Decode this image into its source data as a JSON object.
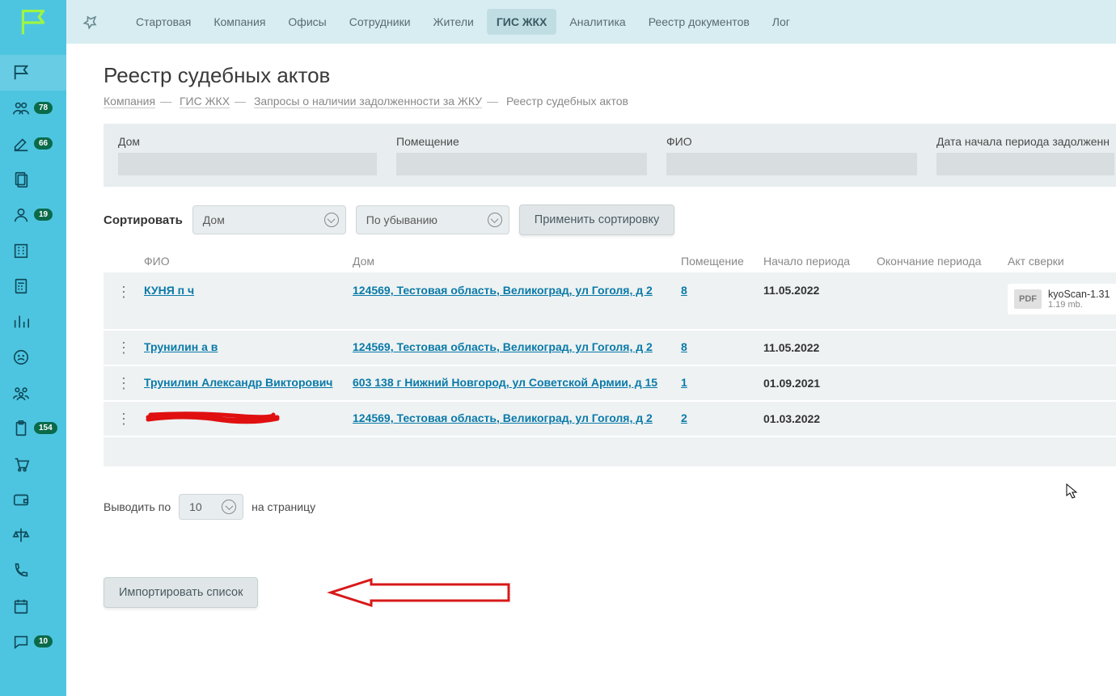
{
  "topnav": {
    "tabs": [
      "Стартовая",
      "Компания",
      "Офисы",
      "Сотрудники",
      "Жители",
      "ГИС ЖКХ",
      "Аналитика",
      "Реестр документов",
      "Лог"
    ],
    "active_index": 5
  },
  "sidebar": {
    "badges": {
      "i1": "78",
      "i2": "66",
      "i4": "19",
      "i11": "154",
      "i15": "10"
    }
  },
  "page": {
    "title": "Реестр судебных актов",
    "breadcrumb": {
      "items": [
        "Компания",
        "ГИС ЖКХ",
        "Запросы о наличии задолженности за ЖКУ"
      ],
      "current": "Реестр судебных актов"
    }
  },
  "filters": {
    "house_label": "Дом",
    "room_label": "Помещение",
    "fio_label": "ФИО",
    "date_start_label": "Дата начала периода задолженн"
  },
  "sort": {
    "label": "Сортировать",
    "field": "Дом",
    "direction": "По убыванию",
    "apply_btn": "Применить сортировку"
  },
  "table": {
    "headers": {
      "fio": "ФИО",
      "house": "Дом",
      "room": "Помещение",
      "start": "Начало периода",
      "end": "Окончание периода",
      "act": "Акт сверки"
    },
    "rows": [
      {
        "fio": "КУНЯ п ч",
        "house": "124569, Тестовая область, Великоград, ул Гоголя, д 2",
        "room": "8",
        "start": "11.05.2022",
        "end": "",
        "file": {
          "name": "kyoScan-1.31",
          "size": "1.19 mb."
        }
      },
      {
        "fio": "Трунилин а в",
        "house": "124569, Тестовая область, Великоград, ул Гоголя, д 2",
        "room": "8",
        "start": "11.05.2022",
        "end": ""
      },
      {
        "fio": "Трунилин Александр Викторович",
        "house": "603 138 г Нижний Новгород, ул Советской Армии, д 15",
        "room": "1",
        "start": "01.09.2021",
        "end": ""
      },
      {
        "fio": "[redacted]",
        "house": "124569, Тестовая область, Великоград, ул Гоголя, д 2",
        "room": "2",
        "start": "01.03.2022",
        "end": "",
        "redacted": true
      }
    ]
  },
  "pager": {
    "prefix": "Выводить по",
    "value": "10",
    "suffix": "на страницу"
  },
  "import_btn": "Импортировать список",
  "pdf_badge": "PDF"
}
